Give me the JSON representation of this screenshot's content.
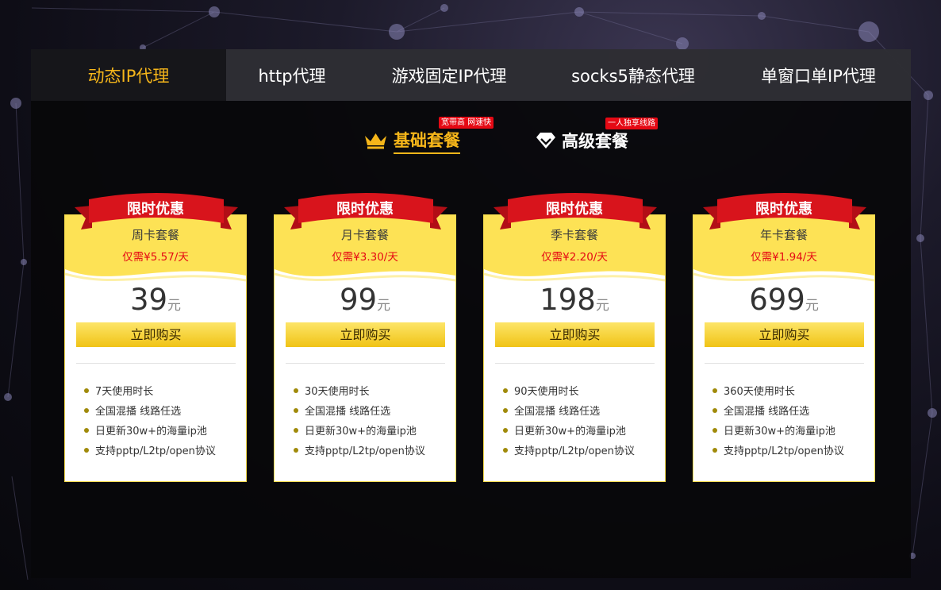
{
  "tabs": [
    {
      "label": "动态IP代理",
      "active": true
    },
    {
      "label": "http代理"
    },
    {
      "label": "游戏固定IP代理"
    },
    {
      "label": "socks5静态代理"
    },
    {
      "label": "单窗口单IP代理"
    }
  ],
  "subtabs": {
    "basic": {
      "label": "基础套餐",
      "tag": "宽带高 网速快",
      "icon": "crown-icon"
    },
    "advanced": {
      "label": "高级套餐",
      "tag": "一人独享线路",
      "icon": "diamond-icon"
    }
  },
  "plans": [
    {
      "ribbon": "限时优惠",
      "name": "周卡套餐",
      "per_day": "仅需¥5.57/天",
      "price": "39",
      "unit": "元",
      "buy_label": "立即购买",
      "features": [
        "7天使用时长",
        "全国混播 线路任选",
        "日更新30w+的海量ip池",
        "支持pptp/L2tp/open协议"
      ]
    },
    {
      "ribbon": "限时优惠",
      "name": "月卡套餐",
      "per_day": "仅需¥3.30/天",
      "price": "99",
      "unit": "元",
      "buy_label": "立即购买",
      "features": [
        "30天使用时长",
        "全国混播 线路任选",
        "日更新30w+的海量ip池",
        "支持pptp/L2tp/open协议"
      ]
    },
    {
      "ribbon": "限时优惠",
      "name": "季卡套餐",
      "per_day": "仅需¥2.20/天",
      "price": "198",
      "unit": "元",
      "buy_label": "立即购买",
      "features": [
        "90天使用时长",
        "全国混播 线路任选",
        "日更新30w+的海量ip池",
        "支持pptp/L2tp/open协议"
      ]
    },
    {
      "ribbon": "限时优惠",
      "name": "年卡套餐",
      "per_day": "仅需¥1.94/天",
      "price": "699",
      "unit": "元",
      "buy_label": "立即购买",
      "features": [
        "360天使用时长",
        "全国混播 线路任选",
        "日更新30w+的海量ip池",
        "支持pptp/L2tp/open协议"
      ]
    }
  ],
  "colors": {
    "accent": "#f6b61a",
    "ribbon": "#d8141c",
    "card_top": "#fde255",
    "tag": "#e50914"
  }
}
